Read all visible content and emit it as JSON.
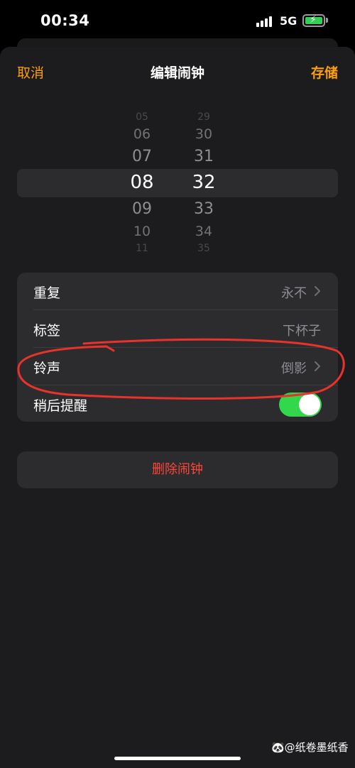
{
  "status_bar": {
    "time": "00:34",
    "network": "5G",
    "battery_icon": "battery-charging-icon",
    "signal_icon": "signal-bars-icon"
  },
  "nav": {
    "cancel": "取消",
    "title": "编辑闹钟",
    "save": "存储",
    "accent_color": "#ff9f0a"
  },
  "time_picker": {
    "hours": [
      "05",
      "06",
      "07",
      "08",
      "09",
      "10",
      "11"
    ],
    "minutes": [
      "29",
      "30",
      "31",
      "32",
      "33",
      "34",
      "35"
    ],
    "selected_hour": "08",
    "selected_minute": "32"
  },
  "settings": {
    "repeat": {
      "label": "重复",
      "value": "永不"
    },
    "label_row": {
      "label": "标签",
      "value": "下杯子"
    },
    "sound": {
      "label": "铃声",
      "value": "倒影"
    },
    "snooze": {
      "label": "稍后提醒",
      "enabled": true,
      "on_color": "#32d74b"
    }
  },
  "delete": {
    "label": "删除闹钟",
    "color": "#ff453a"
  },
  "watermark": "🐼@纸卷墨纸香"
}
